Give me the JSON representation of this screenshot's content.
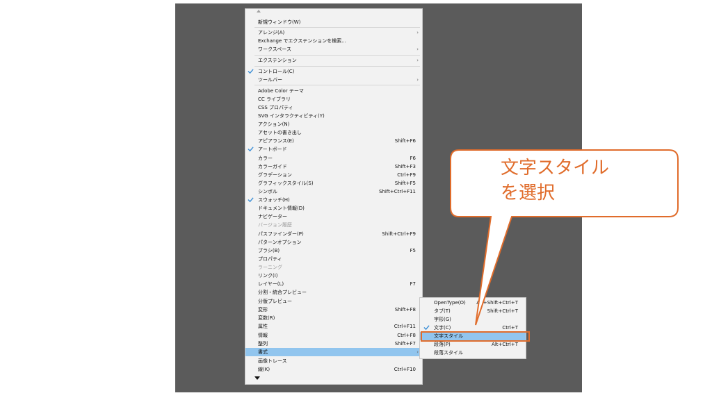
{
  "menu": {
    "items": [
      {
        "label": "新規ウィンドウ(W)"
      },
      {
        "label": "アレンジ(A)",
        "submenu": true
      },
      {
        "label": "Exchange でエクステンションを検索..."
      },
      {
        "label": "ワークスペース",
        "submenu": true
      },
      {
        "label": "エクステンション",
        "submenu": true
      },
      {
        "label": "コントロール(C)",
        "checked": true
      },
      {
        "label": "ツールバー",
        "submenu": true
      },
      {
        "label": "Adobe Color テーマ"
      },
      {
        "label": "CC ライブラリ"
      },
      {
        "label": "CSS プロパティ"
      },
      {
        "label": "SVG インタラクティビティ(Y)"
      },
      {
        "label": "アクション(N)"
      },
      {
        "label": "アセットの書き出し"
      },
      {
        "label": "アピアランス(E)",
        "shortcut": "Shift+F6"
      },
      {
        "label": "アートボード",
        "checked": true
      },
      {
        "label": "カラー",
        "shortcut": "F6"
      },
      {
        "label": "カラーガイド",
        "shortcut": "Shift+F3"
      },
      {
        "label": "グラデーション",
        "shortcut": "Ctrl+F9"
      },
      {
        "label": "グラフィックスタイル(S)",
        "shortcut": "Shift+F5"
      },
      {
        "label": "シンボル",
        "shortcut": "Shift+Ctrl+F11"
      },
      {
        "label": "スウォッチ(H)",
        "checked": true
      },
      {
        "label": "ドキュメント情報(D)"
      },
      {
        "label": "ナビゲーター"
      },
      {
        "label": "バージョン履歴",
        "disabled": true
      },
      {
        "label": "パスファインダー(P)",
        "shortcut": "Shift+Ctrl+F9"
      },
      {
        "label": "パターンオプション"
      },
      {
        "label": "ブラシ(B)",
        "shortcut": "F5"
      },
      {
        "label": "プロパティ"
      },
      {
        "label": "ラーニング",
        "disabled": true
      },
      {
        "label": "リンク(I)"
      },
      {
        "label": "レイヤー(L)",
        "shortcut": "F7"
      },
      {
        "label": "分割・統合プレビュー"
      },
      {
        "label": "分版プレビュー"
      },
      {
        "label": "変形",
        "shortcut": "Shift+F8"
      },
      {
        "label": "変数(R)"
      },
      {
        "label": "属性",
        "shortcut": "Ctrl+F11"
      },
      {
        "label": "情報",
        "shortcut": "Ctrl+F8"
      },
      {
        "label": "整列",
        "shortcut": "Shift+F7"
      },
      {
        "label": "書式",
        "submenu": true,
        "highlighted": true
      },
      {
        "label": "画像トレース"
      },
      {
        "label": "線(K)",
        "shortcut": "Ctrl+F10"
      }
    ]
  },
  "submenu": {
    "items": [
      {
        "label": "OpenType(O)",
        "shortcut": "Alt+Shift+Ctrl+T"
      },
      {
        "label": "タブ(T)",
        "shortcut": "Shift+Ctrl+T"
      },
      {
        "label": "字形(G)"
      },
      {
        "label": "文字(C)",
        "shortcut": "Ctrl+T",
        "checked": true
      },
      {
        "label": "文字スタイル",
        "highlighted": true
      },
      {
        "label": "段落(P)",
        "shortcut": "Alt+Ctrl+T"
      },
      {
        "label": "段落スタイル"
      }
    ]
  },
  "callout": {
    "line1": "文字スタイル",
    "line2": "を選択"
  },
  "colors": {
    "accent": "#e06c2b",
    "highlight": "#91c5ee",
    "check": "#3d8fd6"
  }
}
